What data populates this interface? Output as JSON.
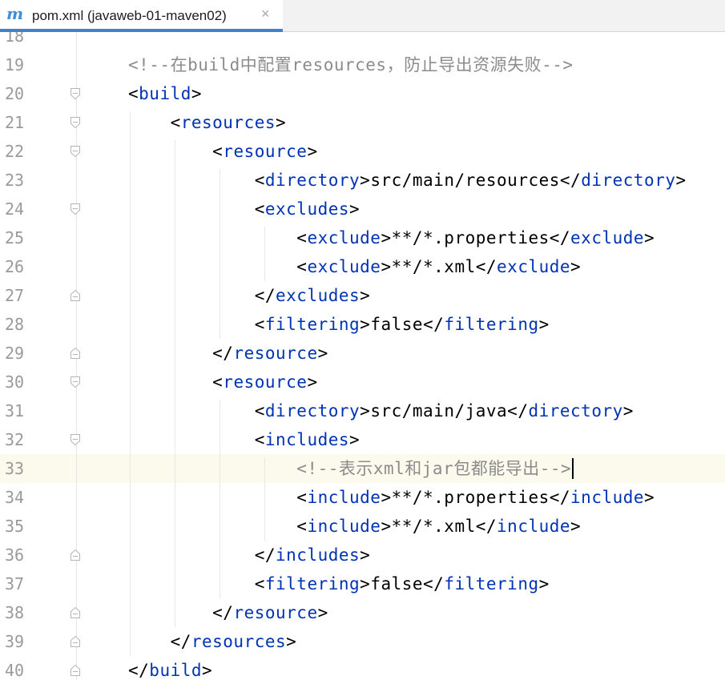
{
  "tab": {
    "icon": "m",
    "title": "pom.xml (javaweb-01-maven02)",
    "close": "×"
  },
  "colors": {
    "tag": "#0033b3",
    "comment": "#8c8c8c",
    "text": "#000000",
    "caret_line": "#fcfaed",
    "tab_accent": "#4083c9"
  },
  "editor": {
    "caret_line": "33",
    "lines": [
      {
        "num": "18",
        "fold": "",
        "segs": []
      },
      {
        "num": "19",
        "fold": "",
        "segs": [
          {
            "k": "c",
            "t": "<!--在build中配置resources，防止导出资源失败-->"
          }
        ]
      },
      {
        "num": "20",
        "fold": "open",
        "segs": [
          {
            "k": "p",
            "t": "<"
          },
          {
            "k": "t",
            "t": "build"
          },
          {
            "k": "p",
            "t": ">"
          }
        ]
      },
      {
        "num": "21",
        "fold": "open",
        "segs": [
          {
            "k": "p",
            "t": "    <"
          },
          {
            "k": "t",
            "t": "resources"
          },
          {
            "k": "p",
            "t": ">"
          }
        ]
      },
      {
        "num": "22",
        "fold": "open",
        "segs": [
          {
            "k": "p",
            "t": "        <"
          },
          {
            "k": "t",
            "t": "resource"
          },
          {
            "k": "p",
            "t": ">"
          }
        ]
      },
      {
        "num": "23",
        "fold": "",
        "segs": [
          {
            "k": "p",
            "t": "            <"
          },
          {
            "k": "t",
            "t": "directory"
          },
          {
            "k": "p",
            "t": ">src/main/resources</"
          },
          {
            "k": "t",
            "t": "directory"
          },
          {
            "k": "p",
            "t": ">"
          }
        ]
      },
      {
        "num": "24",
        "fold": "open",
        "segs": [
          {
            "k": "p",
            "t": "            <"
          },
          {
            "k": "t",
            "t": "excludes"
          },
          {
            "k": "p",
            "t": ">"
          }
        ]
      },
      {
        "num": "25",
        "fold": "",
        "segs": [
          {
            "k": "p",
            "t": "                <"
          },
          {
            "k": "t",
            "t": "exclude"
          },
          {
            "k": "p",
            "t": ">**/*.properties</"
          },
          {
            "k": "t",
            "t": "exclude"
          },
          {
            "k": "p",
            "t": ">"
          }
        ]
      },
      {
        "num": "26",
        "fold": "",
        "segs": [
          {
            "k": "p",
            "t": "                <"
          },
          {
            "k": "t",
            "t": "exclude"
          },
          {
            "k": "p",
            "t": ">**/*.xml</"
          },
          {
            "k": "t",
            "t": "exclude"
          },
          {
            "k": "p",
            "t": ">"
          }
        ]
      },
      {
        "num": "27",
        "fold": "close",
        "segs": [
          {
            "k": "p",
            "t": "            </"
          },
          {
            "k": "t",
            "t": "excludes"
          },
          {
            "k": "p",
            "t": ">"
          }
        ]
      },
      {
        "num": "28",
        "fold": "",
        "segs": [
          {
            "k": "p",
            "t": "            <"
          },
          {
            "k": "t",
            "t": "filtering"
          },
          {
            "k": "p",
            "t": ">false</"
          },
          {
            "k": "t",
            "t": "filtering"
          },
          {
            "k": "p",
            "t": ">"
          }
        ]
      },
      {
        "num": "29",
        "fold": "close",
        "segs": [
          {
            "k": "p",
            "t": "        </"
          },
          {
            "k": "t",
            "t": "resource"
          },
          {
            "k": "p",
            "t": ">"
          }
        ]
      },
      {
        "num": "30",
        "fold": "open",
        "segs": [
          {
            "k": "p",
            "t": "        <"
          },
          {
            "k": "t",
            "t": "resource"
          },
          {
            "k": "p",
            "t": ">"
          }
        ]
      },
      {
        "num": "31",
        "fold": "",
        "segs": [
          {
            "k": "p",
            "t": "            <"
          },
          {
            "k": "t",
            "t": "directory"
          },
          {
            "k": "p",
            "t": ">src/main/java</"
          },
          {
            "k": "t",
            "t": "directory"
          },
          {
            "k": "p",
            "t": ">"
          }
        ]
      },
      {
        "num": "32",
        "fold": "open",
        "segs": [
          {
            "k": "p",
            "t": "            <"
          },
          {
            "k": "t",
            "t": "includes"
          },
          {
            "k": "p",
            "t": ">"
          }
        ]
      },
      {
        "num": "33",
        "fold": "",
        "segs": [
          {
            "k": "c",
            "t": "                <!--表示xml和jar包都能导出-->"
          }
        ]
      },
      {
        "num": "34",
        "fold": "",
        "segs": [
          {
            "k": "p",
            "t": "                <"
          },
          {
            "k": "t",
            "t": "include"
          },
          {
            "k": "p",
            "t": ">**/*.properties</"
          },
          {
            "k": "t",
            "t": "include"
          },
          {
            "k": "p",
            "t": ">"
          }
        ]
      },
      {
        "num": "35",
        "fold": "",
        "segs": [
          {
            "k": "p",
            "t": "                <"
          },
          {
            "k": "t",
            "t": "include"
          },
          {
            "k": "p",
            "t": ">**/*.xml</"
          },
          {
            "k": "t",
            "t": "include"
          },
          {
            "k": "p",
            "t": ">"
          }
        ]
      },
      {
        "num": "36",
        "fold": "close",
        "segs": [
          {
            "k": "p",
            "t": "            </"
          },
          {
            "k": "t",
            "t": "includes"
          },
          {
            "k": "p",
            "t": ">"
          }
        ]
      },
      {
        "num": "37",
        "fold": "",
        "segs": [
          {
            "k": "p",
            "t": "            <"
          },
          {
            "k": "t",
            "t": "filtering"
          },
          {
            "k": "p",
            "t": ">false</"
          },
          {
            "k": "t",
            "t": "filtering"
          },
          {
            "k": "p",
            "t": ">"
          }
        ]
      },
      {
        "num": "38",
        "fold": "close",
        "segs": [
          {
            "k": "p",
            "t": "        </"
          },
          {
            "k": "t",
            "t": "resource"
          },
          {
            "k": "p",
            "t": ">"
          }
        ]
      },
      {
        "num": "39",
        "fold": "close",
        "segs": [
          {
            "k": "p",
            "t": "    </"
          },
          {
            "k": "t",
            "t": "resources"
          },
          {
            "k": "p",
            "t": ">"
          }
        ]
      },
      {
        "num": "40",
        "fold": "close",
        "segs": [
          {
            "k": "p",
            "t": "</"
          },
          {
            "k": "t",
            "t": "build"
          },
          {
            "k": "p",
            "t": ">"
          }
        ]
      }
    ]
  }
}
